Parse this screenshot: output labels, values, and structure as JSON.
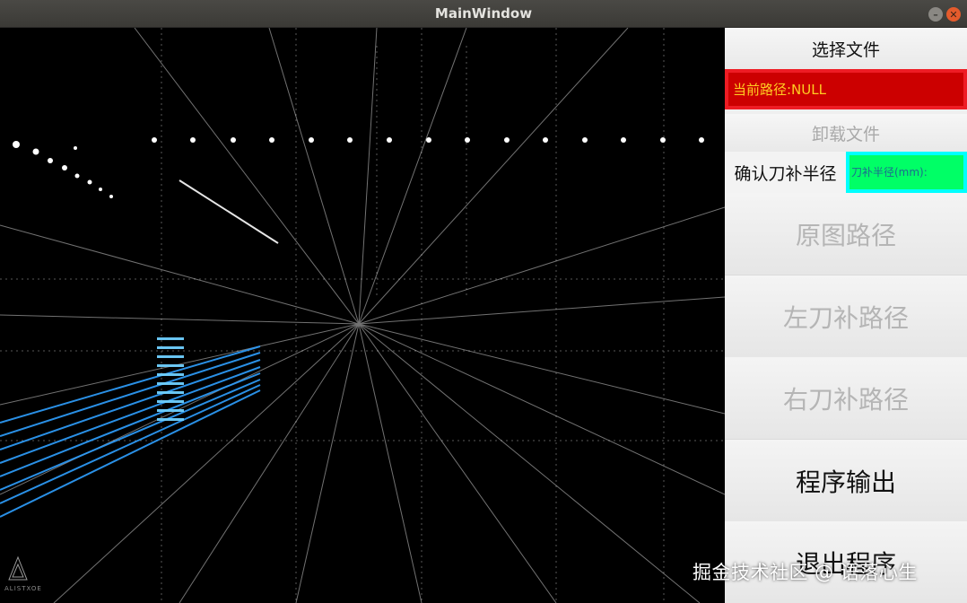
{
  "window": {
    "title": "MainWindow",
    "minimize_glyph": "–",
    "close_glyph": "✕"
  },
  "art": {
    "logo_text": "ALISTXOE"
  },
  "panel": {
    "select_file_label": "选择文件",
    "current_path_label": "当前路径:NULL",
    "unload_file_label": "卸载文件",
    "confirm_radius_label": "确认刀补半径",
    "radius_input_placeholder": "刀补半径(mm):",
    "radius_input_value": "",
    "original_path_label": "原图路径",
    "left_comp_label": "左刀补路径",
    "right_comp_label": "右刀补路径",
    "program_output_label": "程序输出",
    "exit_label": "退出程序"
  },
  "watermark": "掘金技术社区 @ 语落心生",
  "colors": {
    "path_label_bg": "#cc0000",
    "path_label_border": "#ee1c24",
    "path_label_text": "#ffcc22",
    "radius_input_bg": "#00ff66",
    "radius_input_border": "#00ffff",
    "disabled_text": "#b5b5b5"
  }
}
